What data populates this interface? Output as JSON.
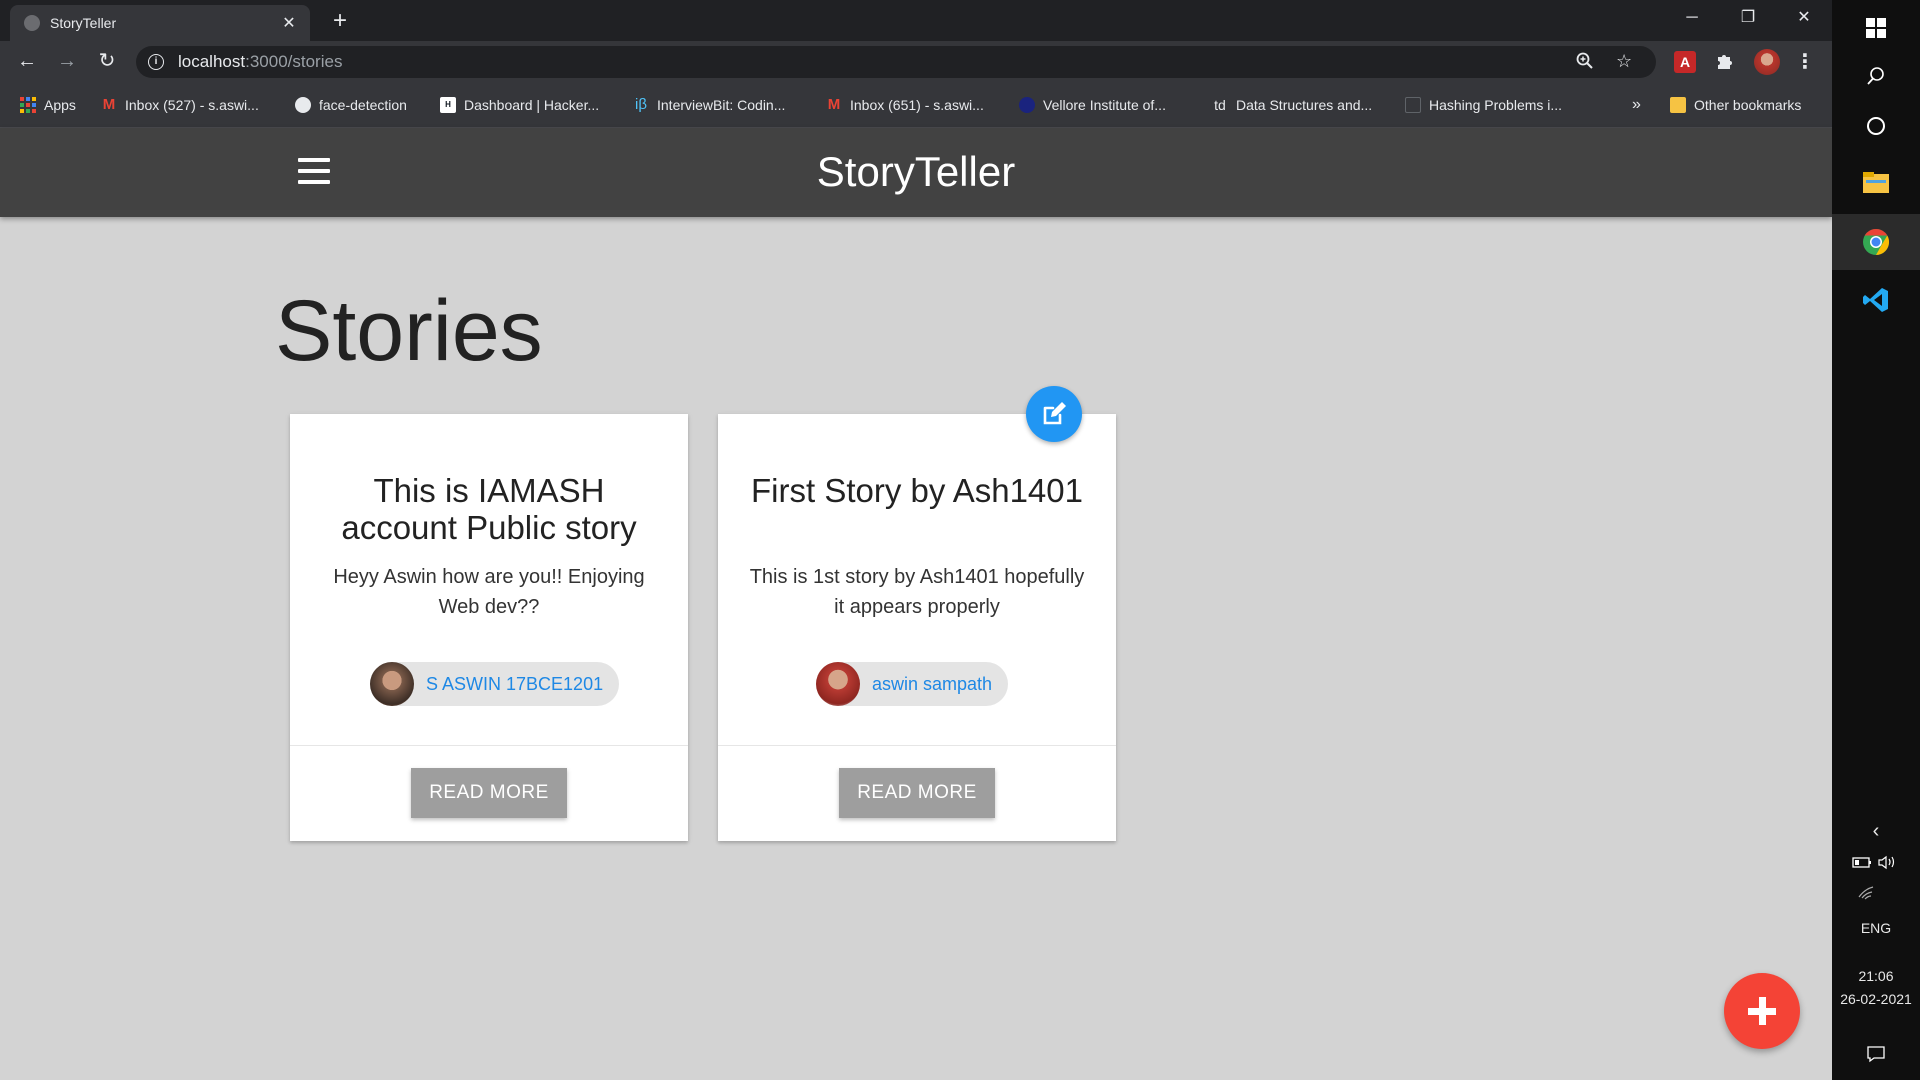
{
  "browser": {
    "tab": {
      "title": "StoryTeller",
      "close": "✕"
    },
    "new_tab": "+",
    "window_controls": {
      "minimize": "─",
      "restore": "❐",
      "close": "✕"
    },
    "nav": {
      "back": "←",
      "forward": "→",
      "reload": "↻"
    },
    "address": {
      "host": "localhost",
      "path": ":3000/stories"
    },
    "bookmarks": [
      {
        "label": "Apps",
        "icon": "apps-grid-icon"
      },
      {
        "label": "Inbox (527) - s.aswi...",
        "icon": "gmail-icon"
      },
      {
        "label": "face-detection",
        "icon": "github-icon"
      },
      {
        "label": "Dashboard | Hacker...",
        "icon": "hackerrank-icon"
      },
      {
        "label": "InterviewBit: Codin...",
        "icon": "interviewbit-icon"
      },
      {
        "label": "Inbox (651) - s.aswi...",
        "icon": "gmail-icon"
      },
      {
        "label": "Vellore Institute of...",
        "icon": "vit-icon"
      },
      {
        "label": "Data Structures and...",
        "icon": "td-icon"
      },
      {
        "label": "Hashing Problems i...",
        "icon": "page-icon"
      }
    ],
    "overflow": "»",
    "other_bookmarks": "Other bookmarks"
  },
  "app": {
    "brand": "StoryTeller",
    "page_title": "Stories",
    "stories": [
      {
        "title": "This is IAMASH account Public story",
        "body": "Heyy Aswin how are you!! Enjoying Web dev??",
        "author": "S ASWIN 17BCE1201",
        "button": "READ MORE"
      },
      {
        "title": "First Story by Ash1401",
        "body": "This is 1st story by Ash1401 hopefully it appears properly",
        "author": "aswin sampath",
        "button": "READ MORE"
      }
    ]
  },
  "taskbar": {
    "language": "ENG",
    "time": "21:06",
    "date": "26-02-2021"
  },
  "colors": {
    "navbar": "#424242",
    "page_bg": "#d3d3d3",
    "link_blue": "#1e88e5",
    "edit_fab": "#2196f3",
    "add_fab": "#f44336",
    "button_grey": "#9e9e9e"
  }
}
